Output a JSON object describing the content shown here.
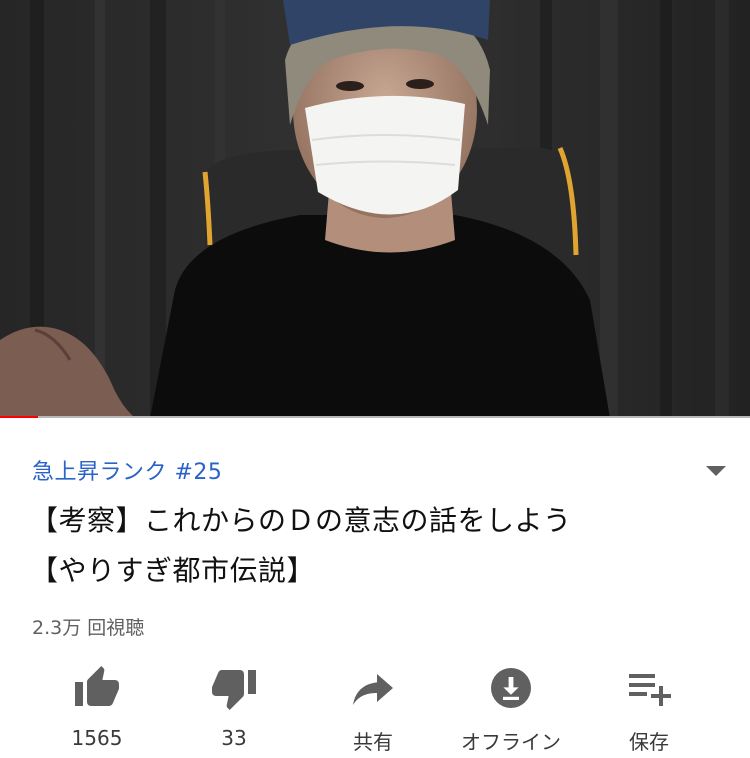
{
  "player": {
    "progress_fraction": 0.05
  },
  "video": {
    "trending_label": "急上昇ランク #25",
    "title_line1": "【考察】これからのＤの意志の話をしよう",
    "title_line2": "【やりすぎ都市伝説】",
    "views": "2.3万 回視聴"
  },
  "actions": {
    "like": {
      "icon": "thumbs-up-icon",
      "label": "1565"
    },
    "dislike": {
      "icon": "thumbs-down-icon",
      "label": "33"
    },
    "share": {
      "icon": "share-icon",
      "label": "共有"
    },
    "offline": {
      "icon": "download-icon",
      "label": "オフライン"
    },
    "save": {
      "icon": "playlist-add-icon",
      "label": "保存"
    }
  },
  "colors": {
    "trending": "#2a62c9",
    "progress": "#ff0000",
    "icon": "#606060"
  }
}
